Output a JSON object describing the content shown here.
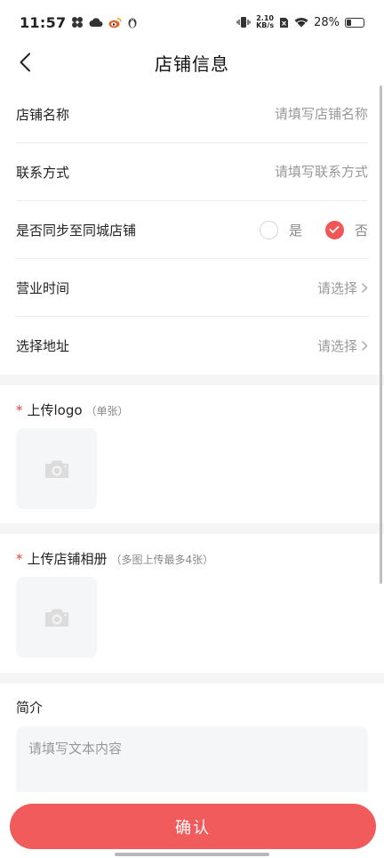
{
  "status_bar": {
    "time": "11:57",
    "net_speed_value": "2.10",
    "net_speed_unit": "KB/s",
    "battery": "28%"
  },
  "header": {
    "title": "店铺信息"
  },
  "form": {
    "shop_name": {
      "label": "店铺名称",
      "placeholder": "请填写店铺名称"
    },
    "contact": {
      "label": "联系方式",
      "placeholder": "请填写联系方式"
    },
    "sync": {
      "label": "是否同步至同城店铺",
      "yes": "是",
      "no": "否",
      "selected": "否"
    },
    "hours": {
      "label": "营业时间",
      "value": "请选择"
    },
    "address": {
      "label": "选择地址",
      "value": "请选择"
    }
  },
  "logo_upload": {
    "required": "*",
    "label": "上传logo",
    "hint": "（单张）"
  },
  "album_upload": {
    "required": "*",
    "label": "上传店铺相册",
    "hint": "（多图上传最多4张）"
  },
  "intro": {
    "label": "简介",
    "placeholder": "请填写文本内容"
  },
  "confirm": {
    "label": "确认"
  },
  "colors": {
    "accent": "#f25b5b",
    "required": "#e5413a",
    "page_bg": "#f5f5f5"
  },
  "icons": [
    "fan-icon",
    "cloud-icon",
    "weibo-icon",
    "linux-icon",
    "vibrate-icon",
    "sim-x-icon",
    "wifi-icon",
    "battery-icon",
    "back-icon",
    "chevron-right-icon",
    "check-icon",
    "camera-icon"
  ]
}
